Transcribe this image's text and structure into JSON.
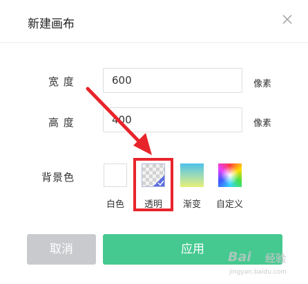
{
  "dialog": {
    "title": "新建画布",
    "close_icon": "close-icon"
  },
  "form": {
    "width_label": "宽 度",
    "width_value": "600",
    "width_unit": "像素",
    "height_label": "高 度",
    "height_value": "400",
    "height_unit": "像素",
    "bg_label": "背景色"
  },
  "backgrounds": {
    "options": [
      {
        "label": "白色",
        "selected": false,
        "icon": "white-swatch"
      },
      {
        "label": "透明",
        "selected": true,
        "icon": "transparent-swatch"
      },
      {
        "label": "渐变",
        "selected": false,
        "icon": "gradient-swatch"
      },
      {
        "label": "自定义",
        "selected": false,
        "icon": "custom-color-swatch"
      }
    ]
  },
  "buttons": {
    "cancel_label": "取消",
    "apply_label": "应用"
  },
  "watermark": {
    "logo": "Bai",
    "text": "经验",
    "url": "jingyan.baidu.com"
  },
  "colors": {
    "accent": "#45c990",
    "cancel": "#c9cacd",
    "highlight": "#e8242b",
    "check": "#5b6ee1"
  }
}
